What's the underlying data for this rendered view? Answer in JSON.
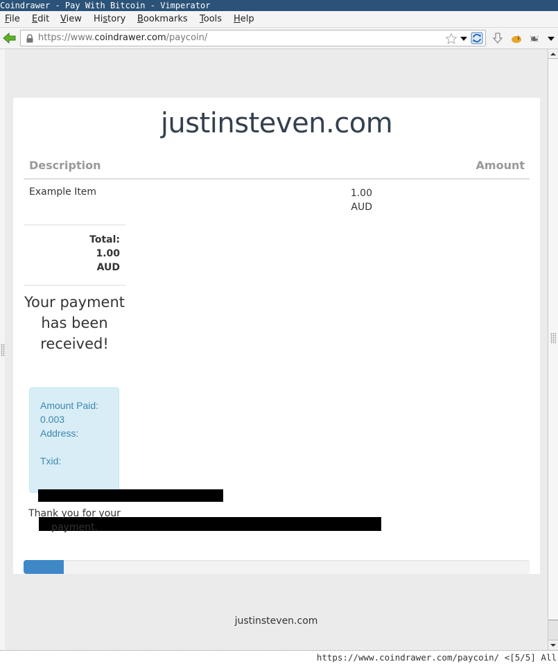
{
  "window": {
    "title": "Coindrawer - Pay With Bitcoin - Vimperator"
  },
  "menubar": {
    "items": [
      {
        "label": "File",
        "accel": "F",
        "rest": "ile"
      },
      {
        "label": "Edit",
        "accel": "E",
        "rest": "dit"
      },
      {
        "label": "View",
        "accel": "V",
        "rest": "iew"
      },
      {
        "label": "History",
        "pre": "Hi",
        "accel": "s",
        "rest": "tory"
      },
      {
        "label": "Bookmarks",
        "accel": "B",
        "rest": "ookmarks"
      },
      {
        "label": "Tools",
        "accel": "T",
        "rest": "ools"
      },
      {
        "label": "Help",
        "accel": "H",
        "rest": "elp"
      }
    ]
  },
  "navbar": {
    "url_prefix": "https://www.",
    "url_domain": "coindrawer.com",
    "url_path": "/paycoin/",
    "icons": [
      "back-arrow-icon",
      "lock-icon",
      "star-icon",
      "dropdown-icon",
      "reload-icon",
      "download-icon",
      "addon-fox-icon",
      "addon-bug-icon",
      "menu-dropdown-icon"
    ]
  },
  "page": {
    "site_title": "justinsteven.com",
    "table": {
      "headers": {
        "description": "Description",
        "amount": "Amount"
      },
      "rows": [
        {
          "description": "Example Item",
          "amount": "1.00",
          "currency": "AUD"
        }
      ]
    },
    "total": {
      "label": "Total:",
      "amount": "1.00",
      "currency": "AUD"
    },
    "status_message": "Your payment has been received!",
    "payment_info": {
      "amount_paid_label": "Amount Paid:",
      "amount_paid_value": "0.003",
      "address_label": "Address:",
      "address_value": "[redacted]",
      "txid_label": "Txid:",
      "txid_value": "[redacted]"
    },
    "thanks_message": "Thank you for your payment.",
    "progress_percent": 8,
    "colors": {
      "progress_fill": "#3f88c8",
      "info_box_bg": "#d9edf7",
      "info_text": "#3a87ad",
      "titlebar": "#2b5278"
    },
    "footer": "justinsteven.com"
  },
  "statusline": {
    "text": "https://www.coindrawer.com/paycoin/ <[5/5] All"
  }
}
